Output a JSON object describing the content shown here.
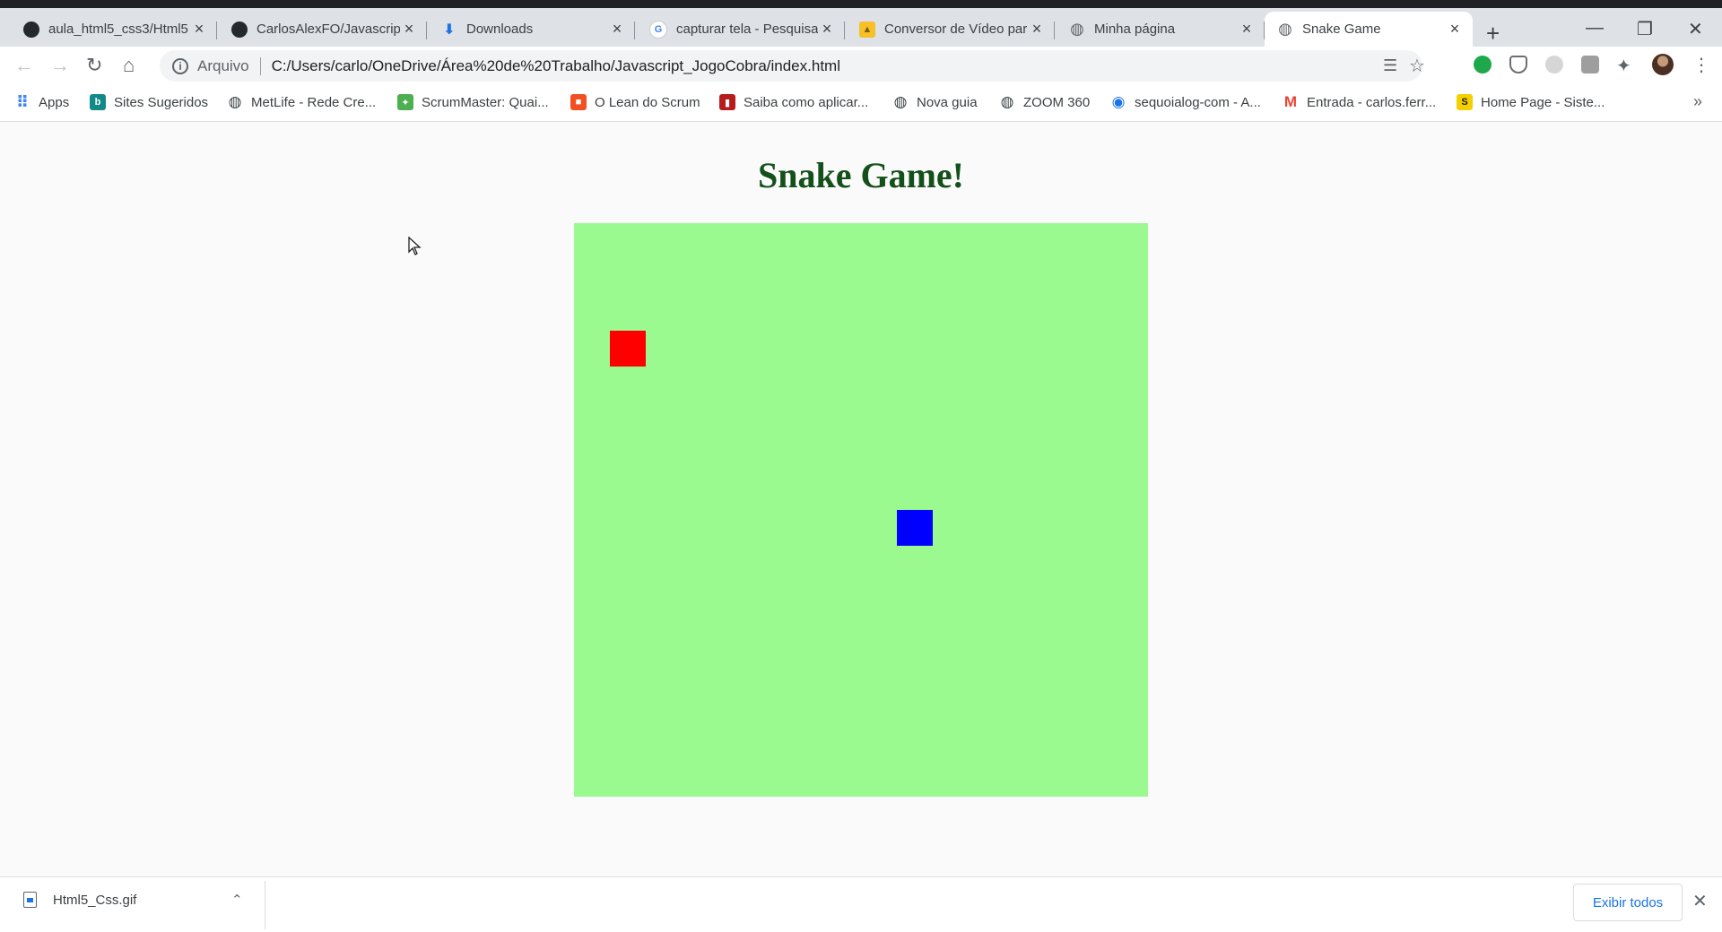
{
  "browser": {
    "tabs": [
      {
        "title": "aula_html5_css3/Html5",
        "icon": "github-icon",
        "icon_color": "#24292e",
        "active": false
      },
      {
        "title": "CarlosAlexFO/Javascript",
        "icon": "github-icon",
        "icon_color": "#24292e",
        "active": false
      },
      {
        "title": "Downloads",
        "icon": "download-icon",
        "icon_color": "#1a73e8",
        "active": false
      },
      {
        "title": "capturar tela - Pesquisa",
        "icon": "google-icon",
        "icon_color": "#ffffff",
        "active": false
      },
      {
        "title": "Conversor de Vídeo para",
        "icon": "converter-icon",
        "icon_color": "#f6c026",
        "active": false
      },
      {
        "title": "Minha página",
        "icon": "globe-icon",
        "icon_color": "#5f6368",
        "active": false
      },
      {
        "title": "Snake Game",
        "icon": "globe-icon",
        "icon_color": "#5f6368",
        "active": true
      }
    ],
    "new_tab_symbol": "+",
    "address": {
      "scheme_label": "Arquivo",
      "url": "C:/Users/carlo/OneDrive/Área%20de%20Trabalho/Javascript_JogoCobra/index.html"
    },
    "bookmarks": [
      {
        "label": "Apps",
        "icon": "apps-icon",
        "color": "#4285f4"
      },
      {
        "label": "Sites Sugeridos",
        "icon": "bing-icon",
        "color": "#138a8a"
      },
      {
        "label": "MetLife - Rede Cre...",
        "icon": "globe-icon",
        "color": "#3c4043"
      },
      {
        "label": "ScrumMaster: Quai...",
        "icon": "scrum-icon",
        "color": "#4caf50"
      },
      {
        "label": "O Lean do Scrum",
        "icon": "microsoft-icon",
        "color": "#f25022"
      },
      {
        "label": "Saiba como aplicar...",
        "icon": "book-icon",
        "color": "#b71c1c"
      },
      {
        "label": "Nova guia",
        "icon": "globe-icon",
        "color": "#3c4043"
      },
      {
        "label": "ZOOM 360",
        "icon": "globe-icon",
        "color": "#3c4043"
      },
      {
        "label": "sequoialog-com - A...",
        "icon": "circle-icon",
        "color": "#1a73e8"
      },
      {
        "label": "Entrada - carlos.ferr...",
        "icon": "gmail-icon",
        "color": "#ea4335"
      },
      {
        "label": "Home Page - Siste...",
        "icon": "s-icon",
        "color": "#f4d000"
      }
    ],
    "bookmarks_more": "»"
  },
  "game": {
    "title": "Snake Game!",
    "board_color": "#9afa90",
    "food": {
      "color": "#ff0000",
      "col": 1,
      "row": 3
    },
    "snake": {
      "color": "#0000ff",
      "col": 9,
      "row": 8
    }
  },
  "downloads": {
    "file": "Html5_Css.gif",
    "show_all": "Exibir todos"
  }
}
